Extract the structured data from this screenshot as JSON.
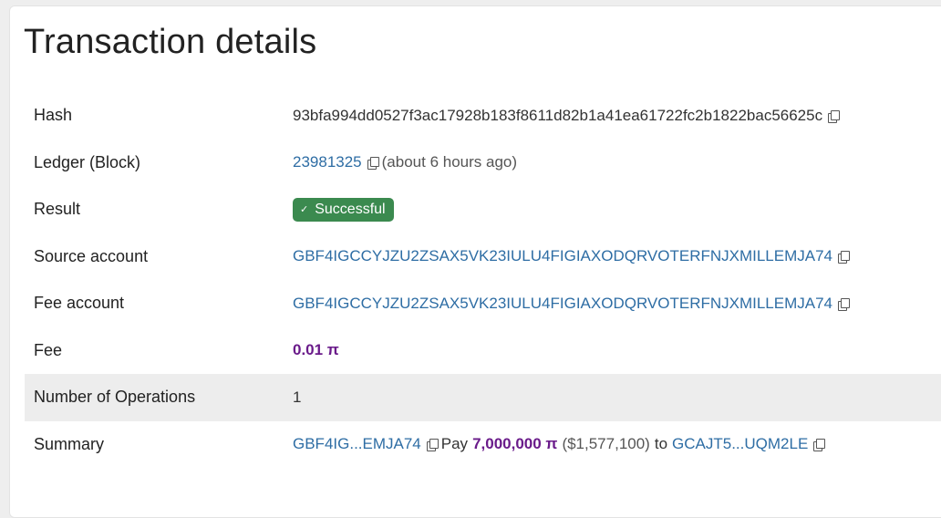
{
  "page": {
    "title": "Transaction details"
  },
  "rows": {
    "hash": {
      "label": "Hash",
      "value": "93bfa994dd0527f3ac17928b183f8611d82b1a41ea61722fc2b1822bac56625c"
    },
    "ledger": {
      "label": "Ledger (Block)",
      "value": "23981325",
      "ago": "(about 6 hours ago)"
    },
    "result": {
      "label": "Result",
      "value": "Successful",
      "icon": "checkmark-icon"
    },
    "source": {
      "label": "Source account",
      "value": "GBF4IGCCYJZU2ZSAX5VK23IULU4FIGIAXODQRVOTERFNJXMILLEMJA74"
    },
    "fee_account": {
      "label": "Fee account",
      "value": "GBF4IGCCYJZU2ZSAX5VK23IULU4FIGIAXODQRVOTERFNJXMILLEMJA74"
    },
    "fee": {
      "label": "Fee",
      "value": "0.01 π"
    },
    "ops": {
      "label": "Number of Operations",
      "value": "1"
    },
    "summary": {
      "label": "Summary",
      "from": "GBF4IG...EMJA74",
      "action": "Pay",
      "amount": "7,000,000 π",
      "usd": "($1,577,100)",
      "to_word": "to",
      "to": "GCAJT5...UQM2LE"
    }
  },
  "colors": {
    "link": "#2e6da4",
    "success_badge": "#3b8a4f",
    "amount": "#6a1b8a"
  }
}
